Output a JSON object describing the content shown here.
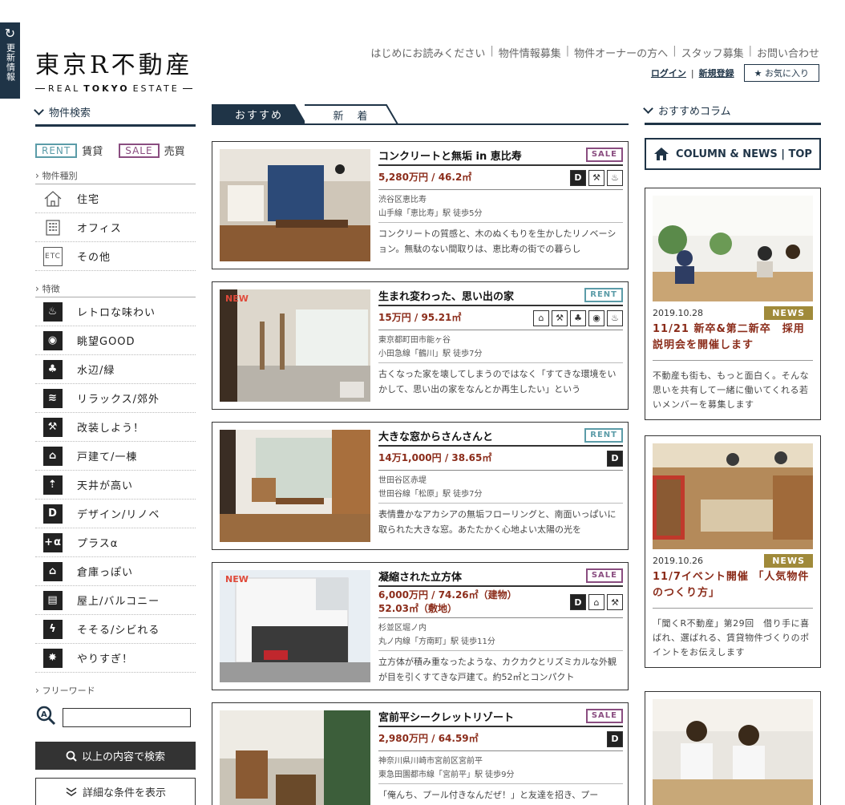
{
  "side_tab": {
    "label": "更新情報"
  },
  "logo": {
    "jp": "東京R不動産",
    "en_a": "REAL",
    "en_b": "TOKYO",
    "en_c": "ESTATE"
  },
  "topnav": {
    "items": [
      "はじめにお読みください",
      "物件情報募集",
      "物件オーナーの方へ",
      "スタッフ募集",
      "お問い合わせ"
    ],
    "separator": "|"
  },
  "usernav": {
    "login": "ログイン",
    "slash": "|",
    "register": "新規登録",
    "favorites": "★ お気に入り"
  },
  "search": {
    "heading": "物件検索",
    "rent_tag": "RENT",
    "rent_label": "賃貸",
    "sale_tag": "SALE",
    "sale_label": "売買",
    "type_heading": "物件種別",
    "types": [
      {
        "label": "住宅",
        "icon": "house-icon"
      },
      {
        "label": "オフィス",
        "icon": "office-icon"
      },
      {
        "label": "その他",
        "icon": "etc-icon",
        "glyph": "ETC"
      }
    ],
    "feature_heading": "特徴",
    "features": [
      {
        "label": "レトロな味わい",
        "icon": "retro-icon",
        "glyph": "♨"
      },
      {
        "label": "眺望GOOD",
        "icon": "view-icon",
        "glyph": "◉"
      },
      {
        "label": "水辺/緑",
        "icon": "waterside-icon",
        "glyph": "♣"
      },
      {
        "label": "リラックス/郊外",
        "icon": "relax-icon",
        "glyph": "≋"
      },
      {
        "label": "改装しよう！",
        "icon": "renovate-icon",
        "glyph": "⚒"
      },
      {
        "label": "戸建て/一棟",
        "icon": "detached-house-icon",
        "glyph": "⌂"
      },
      {
        "label": "天井が高い",
        "icon": "high-ceiling-icon",
        "glyph": "⇡"
      },
      {
        "label": "デザイン/リノベ",
        "icon": "design-icon",
        "glyph": "D"
      },
      {
        "label": "プラスα",
        "icon": "plus-alpha-icon",
        "glyph": "+α"
      },
      {
        "label": "倉庫っぽい",
        "icon": "warehouse-icon",
        "glyph": "⌂"
      },
      {
        "label": "屋上/バルコニー",
        "icon": "rooftop-icon",
        "glyph": "▤"
      },
      {
        "label": "そそる/シビれる",
        "icon": "exciting-icon",
        "glyph": "ϟ"
      },
      {
        "label": "やりすぎ！",
        "icon": "overdone-icon",
        "glyph": "✸"
      }
    ],
    "freeword_heading": "フリーワード",
    "freeword_value": "",
    "search_button": "以上の内容で検索",
    "detail_button": "詳細な条件を表示"
  },
  "tabs": {
    "recommend": "おすすめ",
    "new": "新　着"
  },
  "listings": [
    {
      "title": "コンクリートと無垢 in 恵比寿",
      "badge": "SALE",
      "badge_type": "sale",
      "is_new": false,
      "price": "5,280万円 / 46.2㎡",
      "area": "渋谷区恵比寿",
      "station": "山手線「恵比寿」駅 徒歩5分",
      "desc": "コンクリートの質感と、木のぬくもりを生かしたリノベーション。無駄のない間取りは、恵比寿の街での暮らし",
      "features": [
        "design-icon",
        "renovate-icon",
        "retro-icon"
      ]
    },
    {
      "title": "生まれ変わった、思い出の家",
      "badge": "RENT",
      "badge_type": "rent",
      "is_new": true,
      "price": "15万円 / 95.21㎡",
      "area": "東京都町田市能ヶ谷",
      "station": "小田急線「鶴川」駅 徒歩7分",
      "desc": "古くなった家を壊してしまうのではなく「すてきな環境をいかして、思い出の家をなんとか再生したい」という",
      "features": [
        "detached-house-icon",
        "renovate-icon",
        "waterside-icon",
        "view-icon",
        "retro-icon"
      ]
    },
    {
      "title": "大きな窓からさんさんと",
      "badge": "RENT",
      "badge_type": "rent",
      "is_new": false,
      "price": "14万1,000円 / 38.65㎡",
      "area": "世田谷区赤堤",
      "station": "世田谷線「松原」駅 徒歩7分",
      "desc": "表情豊かなアカシアの無垢フローリングと、南面いっぱいに取られた大きな窓。あたたかく心地よい太陽の光を",
      "features": [
        "design-icon"
      ]
    },
    {
      "title": "凝縮された立方体",
      "badge": "SALE",
      "badge_type": "sale",
      "is_new": true,
      "price": "6,000万円 / 74.26㎡（建物）52.03㎡（敷地）",
      "area": "杉並区堀ノ内",
      "station": "丸ノ内線「方南町」駅 徒歩11分",
      "desc": "立方体が積み重なったような、カクカクとリズミカルな外観が目を引くすてきな戸建て。約52㎡とコンパクト",
      "features": [
        "design-icon",
        "detached-house-icon",
        "renovate-icon"
      ]
    },
    {
      "title": "宮前平シークレットリゾート",
      "badge": "SALE",
      "badge_type": "sale",
      "is_new": false,
      "price": "2,980万円 / 64.59㎡",
      "area": "神奈川県川崎市宮前区宮前平",
      "station": "東急田園都市線「宮前平」駅 徒歩9分",
      "desc": "「俺んち、プール付きなんだぜ！」と友達を招き、プー",
      "features": [
        "design-icon"
      ]
    }
  ],
  "new_flag": "NEW",
  "column": {
    "heading": "おすすめコラム",
    "top_button": "COLUMN & NEWS | TOP",
    "items": [
      {
        "date": "2019.10.28",
        "badge": "NEWS",
        "title": "11/21 新卒&第二新卒　採用説明会を開催します",
        "desc": "不動産も街も、もっと面白く。そんな思いを共有して一緒に働いてくれる若いメンバーを募集します"
      },
      {
        "date": "2019.10.26",
        "badge": "NEWS",
        "title": "11/7イベント開催 「人気物件のつくり方」",
        "desc": "「聞くR不動産」第29回　借り手に喜ばれ、選ばれる、賃貸物件づくりのポイントをお伝えします"
      }
    ]
  },
  "colors": {
    "navy": "#1f3447",
    "rent": "#5b9ca8",
    "sale": "#8a4d80",
    "price": "#8b2c1a",
    "news": "#a08a3a",
    "new_flag": "#e04a3a"
  }
}
